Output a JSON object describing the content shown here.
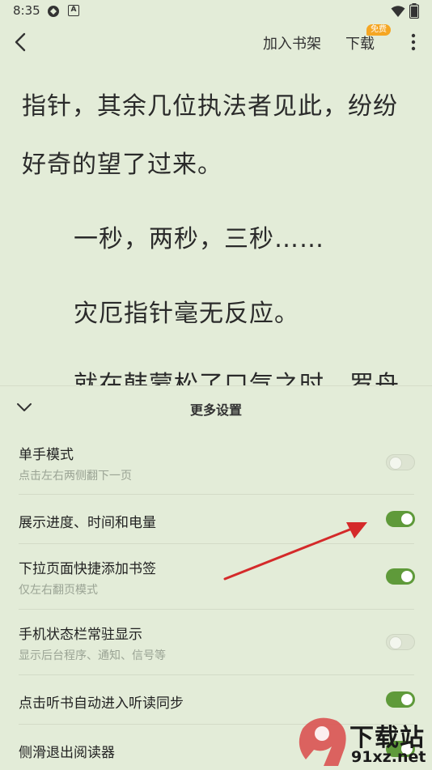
{
  "status_bar": {
    "time": "8:35",
    "notif_icon_letter": "A"
  },
  "top_bar": {
    "add_to_shelf": "加入书架",
    "download": "下载",
    "free_badge": "免费"
  },
  "reader": {
    "lines": [
      "指针，其余几位执法者见此，纷纷",
      "好奇的望了过来。",
      "一秒，两秒，三秒……",
      "灾厄指针毫无反应。",
      "就在韩蒙松了口气之时，罗舟"
    ]
  },
  "panel": {
    "title": "更多设置",
    "rows": [
      {
        "title": "单手模式",
        "subtitle": "点击左右两侧翻下一页",
        "toggle": "off"
      },
      {
        "title": "展示进度、时间和电量",
        "subtitle": "",
        "toggle": "on"
      },
      {
        "title": "下拉页面快捷添加书签",
        "subtitle": "仅左右翻页模式",
        "toggle": "on"
      },
      {
        "title": "手机状态栏常驻显示",
        "subtitle": "显示后台程序、通知、信号等",
        "toggle": "off"
      },
      {
        "title": "点击听书自动进入听读同步",
        "subtitle": "",
        "toggle": "on"
      },
      {
        "title": "侧滑退出阅读器",
        "subtitle": "",
        "toggle": "on"
      }
    ]
  },
  "watermark": {
    "cn": "下载站",
    "url": "91xz.net",
    "logo_digits": "9"
  },
  "colors": {
    "background": "#e3ecd8",
    "toggle_on": "#5f9a3a",
    "arrow": "#d42a2a",
    "badge": "#f5a623"
  }
}
